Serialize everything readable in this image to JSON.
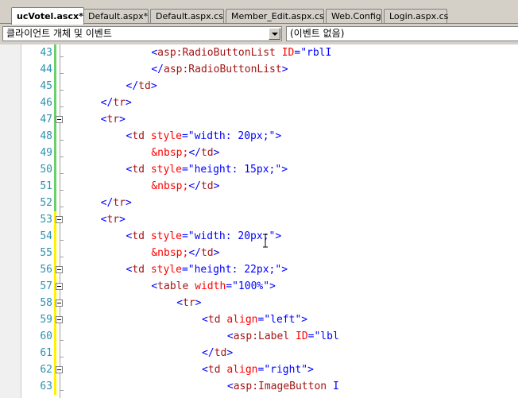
{
  "tabs": [
    {
      "label": "ucVotel.ascx*",
      "active": true
    },
    {
      "label": "Default.aspx*",
      "active": false
    },
    {
      "label": "Default.aspx.cs",
      "active": false
    },
    {
      "label": "Member_Edit.aspx.cs",
      "active": false
    },
    {
      "label": "Web.Config",
      "active": false
    },
    {
      "label": "Login.aspx.cs",
      "active": false
    }
  ],
  "combos": {
    "object_selector": "클라이언트 개체 및 이벤트",
    "event_selector": "(이벤트 없음)"
  },
  "editor": {
    "lines": [
      {
        "num": "43",
        "indent": 11,
        "tokens": [
          [
            "tg",
            "<"
          ],
          [
            "el",
            "asp:RadioButtonList"
          ],
          [
            "tg",
            " "
          ],
          [
            "at",
            "ID"
          ],
          [
            "tg",
            "="
          ],
          [
            "st",
            "\"rblI"
          ]
        ]
      },
      {
        "num": "44",
        "indent": 11,
        "tokens": [
          [
            "tg",
            "</"
          ],
          [
            "el",
            "asp:RadioButtonList"
          ],
          [
            "tg",
            ">"
          ]
        ]
      },
      {
        "num": "45",
        "indent": 10,
        "tokens": [
          [
            "tg",
            "</"
          ],
          [
            "el",
            "td"
          ],
          [
            "tg",
            ">"
          ]
        ]
      },
      {
        "num": "46",
        "indent": 9,
        "tokens": [
          [
            "tg",
            "</"
          ],
          [
            "el",
            "tr"
          ],
          [
            "tg",
            ">"
          ]
        ]
      },
      {
        "num": "47",
        "indent": 9,
        "tokens": [
          [
            "tg",
            "<"
          ],
          [
            "el",
            "tr"
          ],
          [
            "tg",
            ">"
          ]
        ]
      },
      {
        "num": "48",
        "indent": 10,
        "tokens": [
          [
            "tg",
            "<"
          ],
          [
            "el",
            "td"
          ],
          [
            "tg",
            " "
          ],
          [
            "at",
            "style"
          ],
          [
            "tg",
            "="
          ],
          [
            "st",
            "\"width: 20px;\""
          ],
          [
            "tg",
            ">"
          ]
        ]
      },
      {
        "num": "49",
        "indent": 11,
        "tokens": [
          [
            "ent",
            "&nbsp;"
          ],
          [
            "tg",
            "</"
          ],
          [
            "el",
            "td"
          ],
          [
            "tg",
            ">"
          ]
        ]
      },
      {
        "num": "50",
        "indent": 10,
        "tokens": [
          [
            "tg",
            "<"
          ],
          [
            "el",
            "td"
          ],
          [
            "tg",
            " "
          ],
          [
            "at",
            "style"
          ],
          [
            "tg",
            "="
          ],
          [
            "st",
            "\"height: 15px;\""
          ],
          [
            "tg",
            ">"
          ]
        ]
      },
      {
        "num": "51",
        "indent": 11,
        "tokens": [
          [
            "ent",
            "&nbsp;"
          ],
          [
            "tg",
            "</"
          ],
          [
            "el",
            "td"
          ],
          [
            "tg",
            ">"
          ]
        ]
      },
      {
        "num": "52",
        "indent": 9,
        "tokens": [
          [
            "tg",
            "</"
          ],
          [
            "el",
            "tr"
          ],
          [
            "tg",
            ">"
          ]
        ]
      },
      {
        "num": "53",
        "indent": 9,
        "tokens": [
          [
            "tg",
            "<"
          ],
          [
            "el",
            "tr"
          ],
          [
            "tg",
            ">"
          ]
        ]
      },
      {
        "num": "54",
        "indent": 10,
        "tokens": [
          [
            "tg",
            "<"
          ],
          [
            "el",
            "td"
          ],
          [
            "tg",
            " "
          ],
          [
            "at",
            "style"
          ],
          [
            "tg",
            "="
          ],
          [
            "st",
            "\"width: 20px;\""
          ],
          [
            "tg",
            ">"
          ]
        ]
      },
      {
        "num": "55",
        "indent": 11,
        "tokens": [
          [
            "ent",
            "&nbsp;"
          ],
          [
            "tg",
            "</"
          ],
          [
            "el",
            "td"
          ],
          [
            "tg",
            ">"
          ]
        ]
      },
      {
        "num": "56",
        "indent": 10,
        "tokens": [
          [
            "tg",
            "<"
          ],
          [
            "el",
            "td"
          ],
          [
            "tg",
            " "
          ],
          [
            "at",
            "style"
          ],
          [
            "tg",
            "="
          ],
          [
            "st",
            "\"height: 22px;\""
          ],
          [
            "tg",
            ">"
          ]
        ]
      },
      {
        "num": "57",
        "indent": 11,
        "tokens": [
          [
            "tg",
            "<"
          ],
          [
            "el",
            "table"
          ],
          [
            "tg",
            " "
          ],
          [
            "at",
            "width"
          ],
          [
            "tg",
            "="
          ],
          [
            "st",
            "\"100%\""
          ],
          [
            "tg",
            ">"
          ]
        ]
      },
      {
        "num": "58",
        "indent": 12,
        "tokens": [
          [
            "tg",
            "<"
          ],
          [
            "el",
            "tr"
          ],
          [
            "tg",
            ">"
          ]
        ]
      },
      {
        "num": "59",
        "indent": 13,
        "tokens": [
          [
            "tg",
            "<"
          ],
          [
            "el",
            "td"
          ],
          [
            "tg",
            " "
          ],
          [
            "at",
            "align"
          ],
          [
            "tg",
            "="
          ],
          [
            "st",
            "\"left\""
          ],
          [
            "tg",
            ">"
          ]
        ]
      },
      {
        "num": "60",
        "indent": 14,
        "tokens": [
          [
            "tg",
            "<"
          ],
          [
            "el",
            "asp:Label"
          ],
          [
            "tg",
            " "
          ],
          [
            "at",
            "ID"
          ],
          [
            "tg",
            "="
          ],
          [
            "st",
            "\"lbl"
          ]
        ]
      },
      {
        "num": "61",
        "indent": 13,
        "tokens": [
          [
            "tg",
            "</"
          ],
          [
            "el",
            "td"
          ],
          [
            "tg",
            ">"
          ]
        ]
      },
      {
        "num": "62",
        "indent": 13,
        "tokens": [
          [
            "tg",
            "<"
          ],
          [
            "el",
            "td"
          ],
          [
            "tg",
            " "
          ],
          [
            "at",
            "align"
          ],
          [
            "tg",
            "="
          ],
          [
            "st",
            "\"right\""
          ],
          [
            "tg",
            ">"
          ]
        ]
      },
      {
        "num": "63",
        "indent": 14,
        "tokens": [
          [
            "tg",
            "<"
          ],
          [
            "el",
            "asp:ImageButton"
          ],
          [
            "tg",
            " I"
          ]
        ]
      }
    ],
    "fold_markers": [
      "47",
      "53",
      "56",
      "57",
      "58",
      "59",
      "62"
    ],
    "change_markers": {
      "saved": [
        "43",
        "44",
        "45",
        "46",
        "47",
        "48",
        "49",
        "50",
        "51",
        "52"
      ],
      "unsaved": [
        "53",
        "54",
        "55",
        "56",
        "57",
        "58",
        "59",
        "60",
        "61",
        "62",
        "63"
      ]
    }
  },
  "icons": {
    "cursor": "ibeam-cursor-icon",
    "fold": "collapse-minus-icon",
    "dropdown": "chevron-down-icon"
  }
}
